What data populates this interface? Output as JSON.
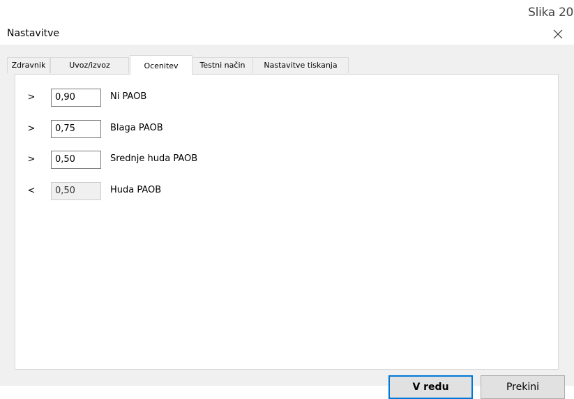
{
  "figure_label": "Slika 20",
  "dialog": {
    "title": "Nastavitve",
    "close_icon": "close-icon"
  },
  "tabs": [
    {
      "label": "Zdravnik",
      "active": false
    },
    {
      "label": "Uvoz/izvoz",
      "active": false
    },
    {
      "label": "Ocenitev",
      "active": true
    },
    {
      "label": "Testni način",
      "active": false
    },
    {
      "label": "Nastavitve tiskanja",
      "active": false
    }
  ],
  "thresholds": [
    {
      "operator": ">",
      "value": "0,90",
      "label": "Ni PAOB",
      "enabled": true
    },
    {
      "operator": ">",
      "value": "0,75",
      "label": "Blaga PAOB",
      "enabled": true
    },
    {
      "operator": ">",
      "value": "0,50",
      "label": "Srednje huda PAOB",
      "enabled": true
    },
    {
      "operator": "<",
      "value": "0,50",
      "label": "Huda PAOB",
      "enabled": false
    }
  ],
  "buttons": {
    "ok_label": "V redu",
    "cancel_label": "Prekini"
  }
}
